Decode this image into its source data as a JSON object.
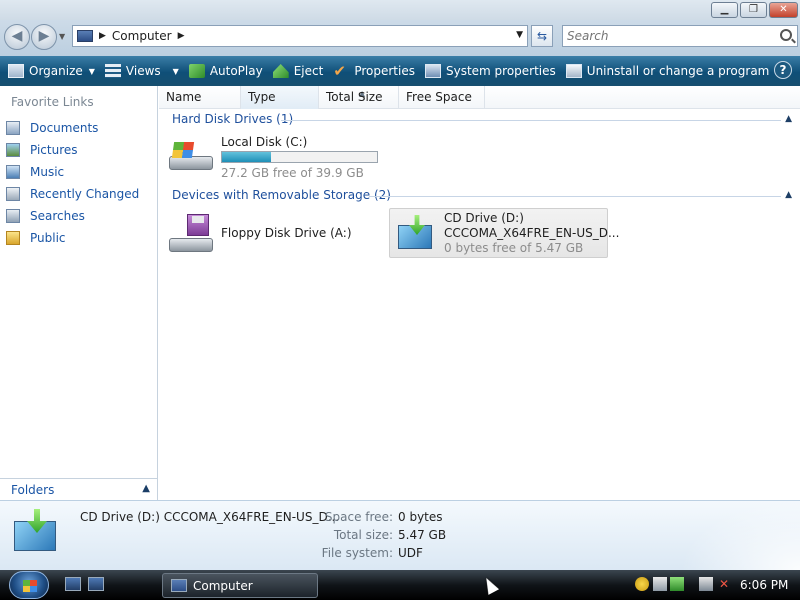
{
  "window": {
    "minimize_label": "▁",
    "maximize_label": "❐",
    "close_label": "✕"
  },
  "address": {
    "path": "Computer",
    "search_placeholder": "Search"
  },
  "toolbar": {
    "organize": "Organize",
    "views": "Views",
    "autoplay": "AutoPlay",
    "eject": "Eject",
    "properties": "Properties",
    "system_properties": "System properties",
    "uninstall": "Uninstall or change a program",
    "help": "?"
  },
  "favorites": {
    "title": "Favorite Links",
    "items": [
      {
        "label": "Documents",
        "icon": "documents-icon"
      },
      {
        "label": "Pictures",
        "icon": "pictures-icon"
      },
      {
        "label": "Music",
        "icon": "music-icon"
      },
      {
        "label": "Recently Changed",
        "icon": "recently-changed-icon"
      },
      {
        "label": "Searches",
        "icon": "searches-icon"
      },
      {
        "label": "Public",
        "icon": "public-folder-icon"
      }
    ],
    "folders_label": "Folders"
  },
  "columns": [
    "Name",
    "Type",
    "Total Size",
    "Free Space"
  ],
  "groups": {
    "hard_disks": "Hard Disk Drives (1)",
    "removable": "Devices with Removable Storage (2)"
  },
  "drives": {
    "local_disk": {
      "name": "Local Disk (C:)",
      "free_text": "27.2 GB free of 39.9 GB",
      "used_fraction": 0.318
    },
    "floppy": {
      "name": "Floppy Disk Drive (A:)"
    },
    "cd": {
      "name": "CD Drive (D:)",
      "label": "CCCOMA_X64FRE_EN-US_D...",
      "free_text": "0 bytes free of 5.47 GB"
    }
  },
  "details": {
    "title": "CD Drive (D:) CCCOMA_X64FRE_EN-US_D...",
    "space_free_label": "Space free:",
    "space_free": "0 bytes",
    "total_size_label": "Total size:",
    "total_size": "5.47 GB",
    "file_system_label": "File system:",
    "file_system": "UDF"
  },
  "taskbar": {
    "task_label": "Computer",
    "clock": "6:06 PM"
  },
  "colors": {
    "toolbar": "#0f4f78",
    "link": "#1a55a5",
    "progress": "#1e8fb7"
  }
}
